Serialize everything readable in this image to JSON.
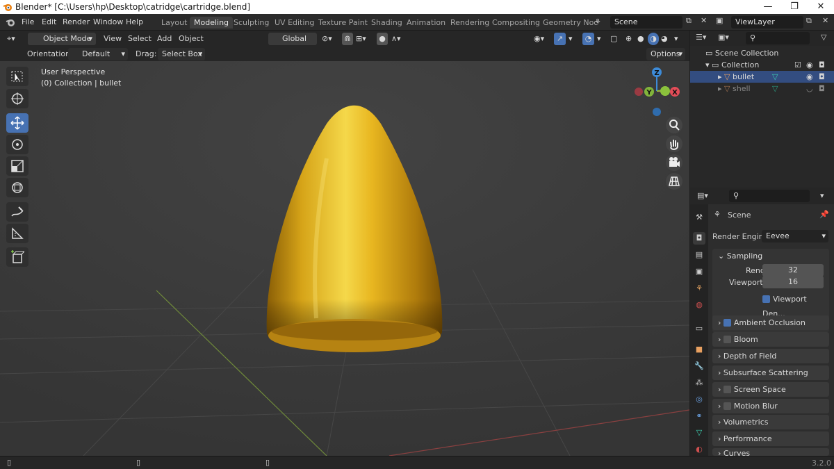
{
  "window": {
    "title": "Blender* [C:\\Users\\hp\\Desktop\\catridge\\cartridge.blend]",
    "min": "—",
    "max": "❐",
    "close": "✕"
  },
  "menu": [
    "File",
    "Edit",
    "Render",
    "Window",
    "Help"
  ],
  "workspaces": [
    "Layout",
    "Modeling",
    "Sculpting",
    "UV Editing",
    "Texture Paint",
    "Shading",
    "Animation",
    "Rendering",
    "Compositing",
    "Geometry Noc"
  ],
  "scene": {
    "name": "Scene",
    "view_layer": "ViewLayer"
  },
  "viewport_header": {
    "mode": "Object Mode",
    "menus": [
      "View",
      "Select",
      "Add",
      "Object"
    ],
    "transform": "Global",
    "options": "Options"
  },
  "tool_settings": {
    "orientation_label": "Orientation:",
    "orientation": "Default",
    "drag_label": "Drag:",
    "drag": "Select Box"
  },
  "overlay": {
    "perspective": "User Perspective",
    "context": "(0) Collection | bullet"
  },
  "gizmo": {
    "z": "Z",
    "y": "Y",
    "x": "X"
  },
  "outliner": {
    "scene_collection": "Scene Collection",
    "collection": "Collection",
    "objects": [
      {
        "name": "bullet",
        "selected": true
      },
      {
        "name": "shell",
        "selected": false
      }
    ]
  },
  "properties": {
    "context": "Scene",
    "render_engine_label": "Render Engine",
    "render_engine": "Eevee",
    "sampling": {
      "title": "Sampling",
      "render_label": "Render",
      "render": "32",
      "viewport_label": "Viewport",
      "viewport": "16",
      "denoise": "Viewport Den..."
    },
    "panels": [
      {
        "name": "Ambient Occlusion",
        "checkbox": true
      },
      {
        "name": "Bloom",
        "checkbox": false
      },
      {
        "name": "Depth of Field"
      },
      {
        "name": "Subsurface Scattering"
      },
      {
        "name": "Screen Space Reflections",
        "checkbox": false
      },
      {
        "name": "Motion Blur",
        "checkbox": false
      },
      {
        "name": "Volumetrics"
      },
      {
        "name": "Performance"
      },
      {
        "name": "Curves"
      }
    ]
  },
  "status": {
    "version": "3.2.0"
  },
  "colors": {
    "accent": "#4772b3",
    "gold": "#d9a61a",
    "axis_x": "#e44d58",
    "axis_y": "#8bc23c",
    "axis_z": "#3d8bd8"
  }
}
